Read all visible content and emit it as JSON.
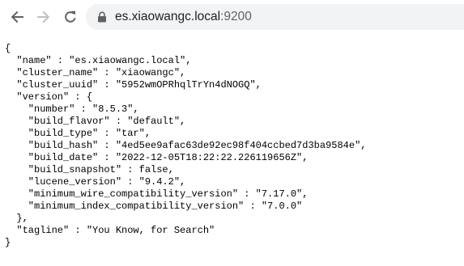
{
  "browser": {
    "url_host": "es.xiaowangc.local",
    "url_port": ":9200",
    "icons": [
      "back-arrow-icon",
      "forward-arrow-icon",
      "reload-icon",
      "lock-icon"
    ]
  },
  "json_view": {
    "open_brace": "{",
    "close_brace": "}",
    "name_line": "  \"name\" : \"es.xiaowangc.local\",",
    "cluster_name_line": "  \"cluster_name\" : \"xiaowangc\",",
    "cluster_uuid_line": "  \"cluster_uuid\" : \"5952wmOPRhqlTrYn4dNOGQ\",",
    "version_open_line": "  \"version\" : {",
    "number_line": "    \"number\" : \"8.5.3\",",
    "build_flavor_line": "    \"build_flavor\" : \"default\",",
    "build_type_line": "    \"build_type\" : \"tar\",",
    "build_hash_line": "    \"build_hash\" : \"4ed5ee9afac63de92ec98f404ccbed7d3ba9584e\",",
    "build_date_line": "    \"build_date\" : \"2022-12-05T18:22:22.226119656Z\",",
    "build_snapshot_line": "    \"build_snapshot\" : false,",
    "lucene_version_line": "    \"lucene_version\" : \"9.4.2\",",
    "min_wire_line": "    \"minimum_wire_compatibility_version\" : \"7.17.0\",",
    "min_index_line": "    \"minimum_index_compatibility_version\" : \"7.0.0\"",
    "version_close_line": "  },",
    "tagline_line": "  \"tagline\" : \"You Know, for Search\""
  }
}
